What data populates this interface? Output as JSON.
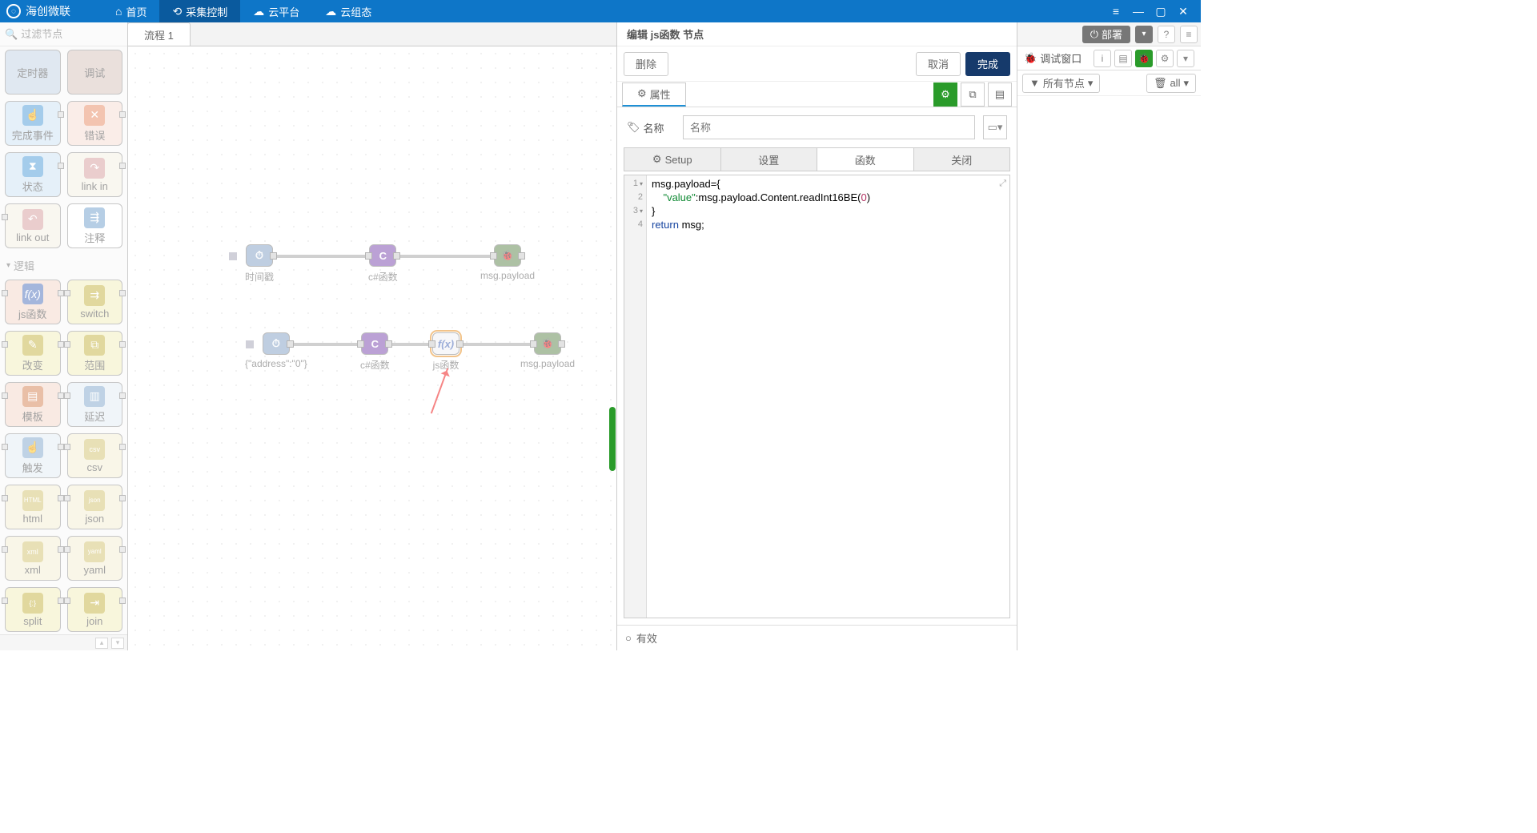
{
  "app": {
    "name": "海创微联"
  },
  "topnav": {
    "home": "首页",
    "collect": "采集控制",
    "cloud": "云平台",
    "config": "云组态"
  },
  "filter": {
    "placeholder": "过滤节点"
  },
  "palette": {
    "row1": [
      {
        "label": "定时器"
      },
      {
        "label": "调试"
      }
    ],
    "row2": [
      {
        "label": "完成事件",
        "bg": "#7db3e2"
      },
      {
        "label": "错误",
        "bg": "#f2b5a6"
      }
    ],
    "row3": [
      {
        "label": "状态",
        "bg": "#7db3e2"
      },
      {
        "label": "link in",
        "bg": "#e8e0d0"
      }
    ],
    "row4": [
      {
        "label": "link out",
        "bg": "#e8e0d0"
      },
      {
        "label": "注释",
        "bg": "#fff"
      }
    ],
    "cat_logic": "逻辑",
    "row5": [
      {
        "label": "js函数",
        "bg": "#e38f6f"
      },
      {
        "label": "switch",
        "bg": "#e0d87a"
      }
    ],
    "row6": [
      {
        "label": "改变",
        "bg": "#e0d87a"
      },
      {
        "label": "范围",
        "bg": "#e0d87a"
      }
    ],
    "row7": [
      {
        "label": "模板",
        "bg": "#e38f6f"
      },
      {
        "label": "延迟",
        "bg": "#d5e3f0"
      }
    ],
    "row8": [
      {
        "label": "触发",
        "bg": "#d5e3f0"
      },
      {
        "label": "csv",
        "bg": "#efe7c5"
      }
    ],
    "row9": [
      {
        "label": "html",
        "bg": "#efe7c5"
      },
      {
        "label": "json",
        "bg": "#efe7c5"
      }
    ],
    "row10": [
      {
        "label": "xml",
        "bg": "#efe7c5"
      },
      {
        "label": "yaml",
        "bg": "#efe7c5"
      }
    ],
    "row11": [
      {
        "label": "split",
        "bg": "#e0d87a"
      },
      {
        "label": "join",
        "bg": "#e0d87a"
      }
    ],
    "row12": [
      {
        "label": "",
        "bg": "#e0d87a"
      },
      {
        "label": "",
        "bg": "#e0d87a"
      }
    ]
  },
  "flow": {
    "tab": "流程 1"
  },
  "nodes": {
    "r1": {
      "a": "时间戳",
      "b": "c#函数",
      "c": "msg.payload"
    },
    "r2": {
      "a": "{\"address\":\"0\"}",
      "b": "c#函数",
      "c": "js函数",
      "d": "msg.payload"
    }
  },
  "edit": {
    "title": "编辑 js函数 节点",
    "delete": "删除",
    "cancel": "取消",
    "done": "完成",
    "tab_props": "属性",
    "name_label": "名称",
    "name_ph": "名称",
    "tabs": {
      "setup": "Setup",
      "init": "设置",
      "func": "函数",
      "close": "关闭"
    },
    "footer": "有效",
    "code": {
      "l1a": "msg.payload={",
      "l2a": "\"value\"",
      "l2b": ":msg.payload.Content.readInt16BE(",
      "l2c": "0",
      "l2d": ")",
      "l3": "}",
      "l4a": "return",
      "l4b": " msg;"
    }
  },
  "right": {
    "deploy": "部署",
    "title": "调试窗口",
    "filter_all": "所有节点",
    "trash": "all"
  }
}
